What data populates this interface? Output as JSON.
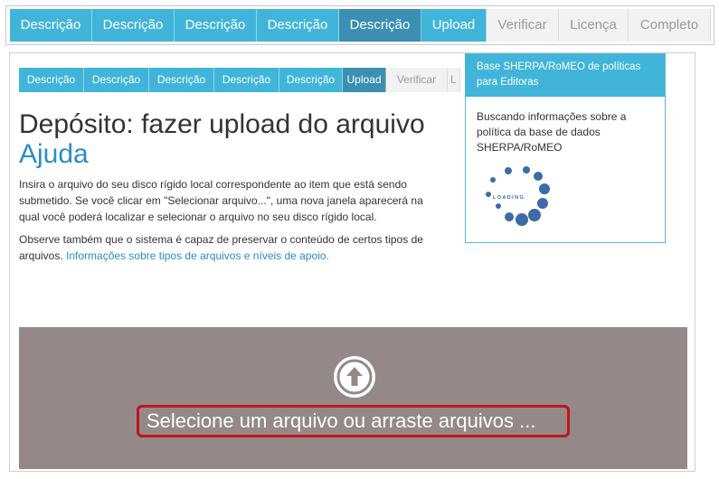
{
  "top_steps": [
    {
      "label": "Descrição",
      "state": "done"
    },
    {
      "label": "Descrição",
      "state": "done"
    },
    {
      "label": "Descrição",
      "state": "done"
    },
    {
      "label": "Descrição",
      "state": "done"
    },
    {
      "label": "Descrição",
      "state": "active-dark"
    },
    {
      "label": "Upload",
      "state": "active"
    },
    {
      "label": "Verificar",
      "state": "future"
    },
    {
      "label": "Licença",
      "state": "future"
    },
    {
      "label": "Completo",
      "state": "future"
    }
  ],
  "inner_steps": [
    {
      "label": "Descrição",
      "state": "done"
    },
    {
      "label": "Descrição",
      "state": "done"
    },
    {
      "label": "Descrição",
      "state": "done"
    },
    {
      "label": "Descrição",
      "state": "done"
    },
    {
      "label": "Descrição",
      "state": "done"
    },
    {
      "label": "Upload",
      "state": "active"
    },
    {
      "label": "Verificar",
      "state": "future"
    },
    {
      "label": "L",
      "state": "future"
    }
  ],
  "page": {
    "title": "Depósito: fazer upload do arquivo",
    "help_link": "Ajuda",
    "paragraph1": "Insira o arquivo do seu disco rígido local correspondente ao item que está sendo submetido. Se você clicar em \"Selecionar arquivo...\", uma nova janela aparecerá na qual você poderá localizar e selecionar o arquivo no seu disco rígido local.",
    "paragraph2_text": "Observe também que o sistema é capaz de preservar o conteúdo de certos tipos de arquivos. ",
    "paragraph2_link": "Informações sobre tipos de arquivos e níveis de apoio."
  },
  "sherpa": {
    "header": "Base SHERPA/RoMEO de políticas para Editoras",
    "body": "Buscando informações sobre a política da base de dados SHERPA/RoMEO",
    "loading_text": "LOADING"
  },
  "dropzone": {
    "label": "Selecione um arquivo ou arraste arquivos ...",
    "icon": "upload-arrow-icon"
  },
  "colors": {
    "accent": "#41b4d9",
    "accent_dark": "#3a8fb3",
    "dropzone_bg": "#948988",
    "highlight_border": "#c0141c"
  }
}
